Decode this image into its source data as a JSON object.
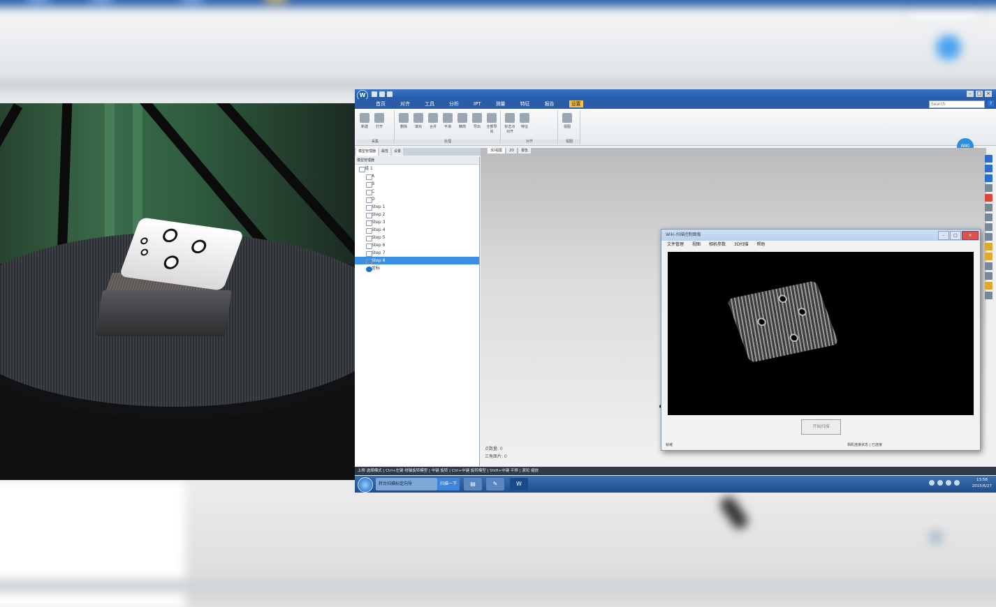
{
  "background": {
    "description_colors": {
      "accent": "#2a5aa6",
      "viewport": "#dadbdc"
    }
  },
  "app": {
    "logo_letter": "W",
    "menu": [
      "首页",
      "对齐",
      "工具",
      "分析",
      "IPT",
      "测量",
      "特征",
      "报告",
      "设置"
    ],
    "active_menu_index": 8,
    "search_placeholder": "Search",
    "ribbon_groups": [
      {
        "label": "采集",
        "buttons": [
          "新建",
          "打开"
        ]
      },
      {
        "label": "处理",
        "buttons": [
          "删除",
          "填充",
          "合并",
          "平滑",
          "精简",
          "导出",
          "全部导出"
        ]
      },
      {
        "label": "对齐",
        "buttons": [
          "标志点对齐",
          "特征"
        ]
      },
      {
        "label": "视图",
        "buttons": [
          "视图"
        ]
      }
    ],
    "ribbon_logo": "WiKi",
    "panel_tabs": [
      "模型管理器",
      "属性",
      "设置"
    ],
    "tree_header": "模型管理器",
    "tree": [
      {
        "label": "组 1",
        "level": 0
      },
      {
        "label": "A",
        "level": 1
      },
      {
        "label": "B",
        "level": 1
      },
      {
        "label": "C",
        "level": 1
      },
      {
        "label": "D",
        "level": 1
      },
      {
        "label": "Step 1",
        "level": 1
      },
      {
        "label": "Step 2",
        "level": 1
      },
      {
        "label": "Step 3",
        "level": 1
      },
      {
        "label": "Step 4",
        "level": 1
      },
      {
        "label": "Step 5",
        "level": 1
      },
      {
        "label": "Step 6",
        "level": 1
      },
      {
        "label": "Step 7",
        "level": 1
      },
      {
        "label": "Step 8",
        "level": 1,
        "selected": true
      },
      {
        "label": "坐标",
        "level": 1,
        "blue": true
      }
    ],
    "viewport_tabs": [
      "3D视图",
      "2D",
      "报告"
    ],
    "viewport_info": [
      "点数量: 0",
      "三角面片: 0"
    ],
    "status_bar": "上移  选择模式 | Ctrl+左键 绕轴旋转模型 | 中键 旋转 | Ctrl+中键 旋转模型 | Shift+中键 平移 | 滚轮 缩放"
  },
  "dialog": {
    "title": "Wiki-扫描控制面板",
    "menu": [
      "文件管理",
      "视图",
      "相机参数",
      "3D扫描",
      "帮助"
    ],
    "button_label": "开始扫描",
    "status_left": "就绪",
    "status_mid": "相机连接状态 | 已连接"
  },
  "taskbar": {
    "items": [
      "转台扫描标定向导",
      "扫描一下"
    ],
    "time": "13:58",
    "date": "2015/6/27"
  }
}
